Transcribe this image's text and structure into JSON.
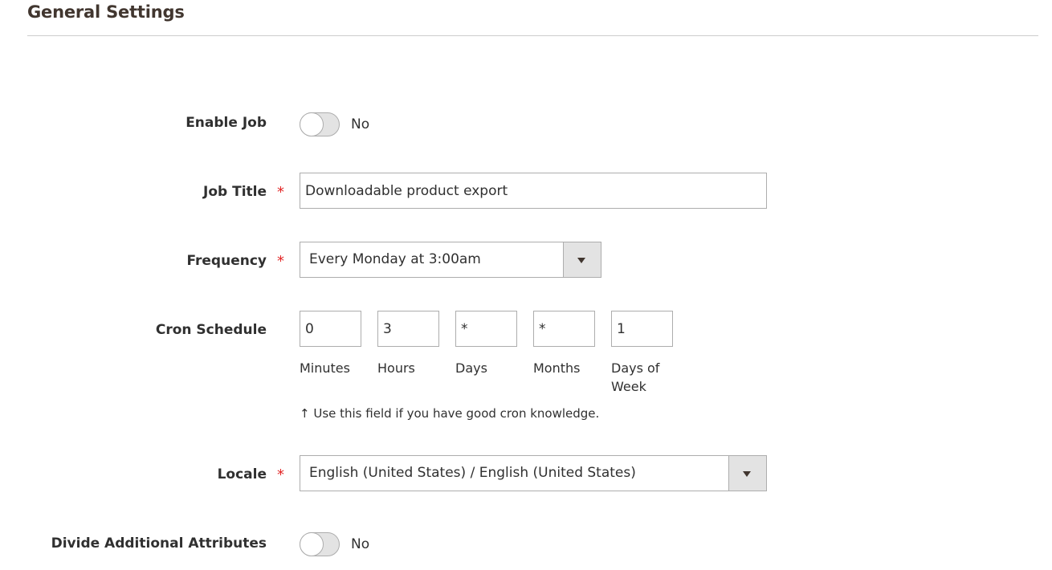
{
  "section": {
    "title": "General Settings"
  },
  "fields": {
    "enable_job": {
      "label": "Enable Job",
      "value": "No"
    },
    "job_title": {
      "label": "Job Title",
      "required_mark": "*",
      "value": "Downloadable product export"
    },
    "frequency": {
      "label": "Frequency",
      "required_mark": "*",
      "selected": "Every Monday at 3:00am"
    },
    "cron": {
      "label": "Cron Schedule",
      "parts": [
        {
          "value": "0",
          "label": "Minutes"
        },
        {
          "value": "3",
          "label": "Hours"
        },
        {
          "value": "*",
          "label": "Days"
        },
        {
          "value": "*",
          "label": "Months"
        },
        {
          "value": "1",
          "label": "Days of Week"
        }
      ],
      "note": "↑ Use this field if you have good cron knowledge."
    },
    "locale": {
      "label": "Locale",
      "required_mark": "*",
      "selected": "English (United States) / English (United States)"
    },
    "divide_attributes": {
      "label": "Divide Additional Attributes",
      "value": "No"
    }
  },
  "icons": {
    "select_arrow": "chevron-down-icon"
  },
  "colors": {
    "required": "#e22626",
    "border": "#adadad",
    "toggle_off": "#e3e3e3",
    "rule": "#cccccc"
  }
}
